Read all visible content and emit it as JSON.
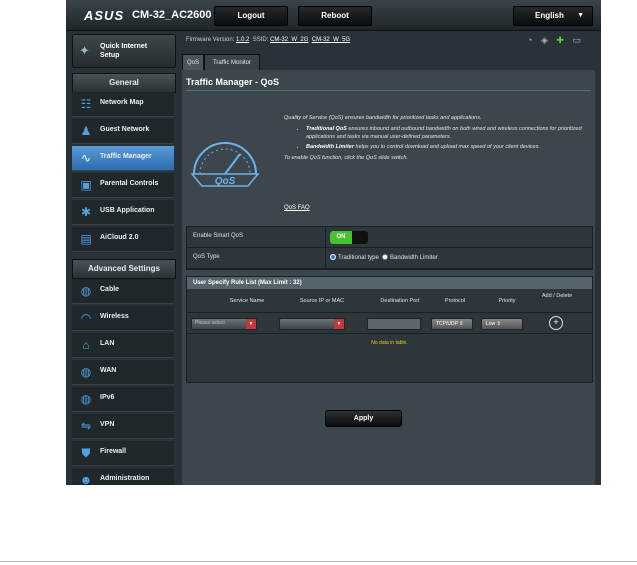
{
  "topbar": {
    "logo": "ASUS",
    "model": "CM-32_AC2600",
    "logout": "Logout",
    "reboot": "Reboot",
    "language": "English"
  },
  "sidebar": {
    "quick_setup": "Quick Internet Setup",
    "general_header": "General",
    "general_items": [
      {
        "label": "Network Map",
        "icon": "network-map-icon"
      },
      {
        "label": "Guest Network",
        "icon": "guest-network-icon"
      },
      {
        "label": "Traffic Manager",
        "icon": "traffic-manager-icon",
        "active": true
      },
      {
        "label": "Parental Controls",
        "icon": "parental-controls-icon"
      },
      {
        "label": "USB Application",
        "icon": "usb-application-icon"
      },
      {
        "label": "AiCloud 2.0",
        "icon": "aicloud-icon"
      }
    ],
    "advanced_header": "Advanced Settings",
    "advanced_items": [
      {
        "label": "Cable",
        "icon": "globe-icon"
      },
      {
        "label": "Wireless",
        "icon": "wireless-icon"
      },
      {
        "label": "LAN",
        "icon": "home-icon"
      },
      {
        "label": "WAN",
        "icon": "globe-icon"
      },
      {
        "label": "IPv6",
        "icon": "globe-icon"
      },
      {
        "label": "VPN",
        "icon": "vpn-icon"
      },
      {
        "label": "Firewall",
        "icon": "shield-icon"
      },
      {
        "label": "Administration",
        "icon": "user-icon"
      }
    ]
  },
  "status": {
    "firmware_label": "Firmware Version:",
    "firmware_value": "1.0.2",
    "ssid_label": "SSID:",
    "ssid_values": [
      "CM-32_W_2G",
      "CM-32_W_5G"
    ]
  },
  "tabs": [
    "QoS",
    "Traffic Monitor"
  ],
  "page": {
    "title": "Traffic Manager - QoS",
    "gauge_label": "QoS",
    "intro": "Quality of Service (QoS) ensures bandwidth for prioritized tasks and applications.",
    "bullets": [
      {
        "term": "Traditional QoS",
        "text": " ensures inbound and outbound bandwidth on both wired and wireless connections for prioritized applications and tasks via manual user-defined parameters."
      },
      {
        "term": "Bandwidth Limiter",
        "text": " helps you to control download and upload max speed of your client devices."
      }
    ],
    "enable_hint": "To enable QoS function, click the QoS slide switch.",
    "faq": "QoS FAQ"
  },
  "settings": {
    "enable_label": "Enable Smart QoS",
    "enable_state": "ON",
    "type_label": "QoS Type",
    "type_options": [
      "Traditional type",
      "Bandwidth Limiter"
    ]
  },
  "rules": {
    "header": "User Specify Rule List (Max Limit : 32)",
    "columns": [
      "Service Name",
      "Source IP or MAC",
      "Destination Port",
      "Protocol",
      "Priority",
      "Add / Delete"
    ],
    "service_placeholder": "Please select",
    "protocol_value": "TCP/UDP",
    "priority_value": "Low",
    "no_data": "No data in table."
  },
  "apply_label": "Apply",
  "colors": {
    "accent": "#2b6db0",
    "switch_on": "#47c230",
    "no_data": "#f3c51c"
  }
}
